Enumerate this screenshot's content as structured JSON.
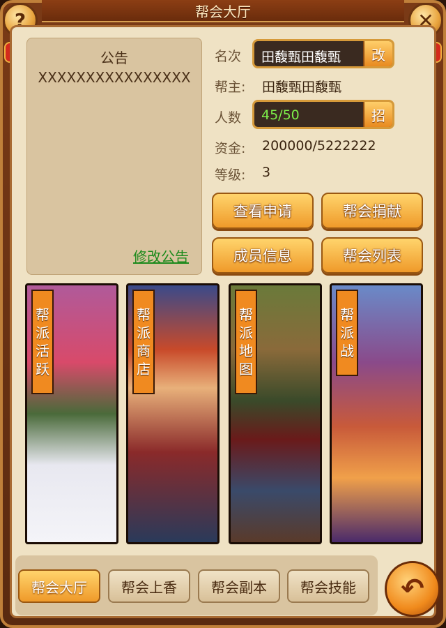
{
  "window": {
    "title": "帮会大厅",
    "help_icon": "help-icon",
    "close_icon": "close-icon",
    "help_label": "?",
    "close_label": "✕"
  },
  "notice": {
    "title": "公告",
    "body": "XXXXXXXXXXXXXXXX",
    "edit_link": "修改公告"
  },
  "info": {
    "name_label": "名次",
    "name_value": "田馥甄田馥甄",
    "rename_button": "改",
    "leader_label": "帮主:",
    "leader_value": "田馥甄田馥甄",
    "members_label": "人数",
    "members_value": "45/50",
    "recruit_button": "招",
    "funds_label": "资金:",
    "funds_value": "200000/5222222",
    "level_label": "等级:",
    "level_value": "3"
  },
  "actions": {
    "view_applications": "查看申请",
    "guild_donation": "帮会捐献",
    "member_info": "成员信息",
    "guild_list": "帮会列表"
  },
  "cards": [
    {
      "label": [
        "帮",
        "派",
        "活",
        "跃"
      ]
    },
    {
      "label": [
        "帮",
        "派",
        "商",
        "店"
      ]
    },
    {
      "label": [
        "帮",
        "派",
        "地",
        "图"
      ]
    },
    {
      "label": [
        "帮",
        "派",
        "战"
      ]
    }
  ],
  "tabs": [
    {
      "label": "帮会大厅",
      "active": true
    },
    {
      "label": "帮会上香",
      "active": false
    },
    {
      "label": "帮会副本",
      "active": false
    },
    {
      "label": "帮会技能",
      "active": false
    }
  ],
  "back_button": {
    "icon": "back-arrow-icon",
    "glyph": "↶"
  },
  "colors": {
    "accent_orange": "#ef9a2a",
    "frame_brown": "#7a3a16",
    "panel_beige": "#efe2c4",
    "members_green": "#7ef04a",
    "link_green": "#1c8a1c"
  }
}
